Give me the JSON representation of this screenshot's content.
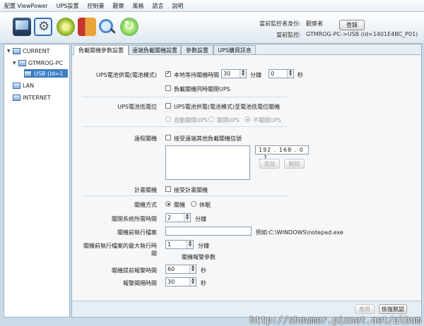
{
  "menu": [
    "配置 ViewPower",
    "UPS設置",
    "控制臺",
    "觀察",
    "風格",
    "語言",
    "說明"
  ],
  "toolbar": {
    "monitor_identity_label": "當前監控者身份:",
    "monitor_identity_value": "觀察者",
    "login_button": "登錄",
    "current_monitor_label": "當前監控:",
    "current_monitor_value": "GTMROG-PC->USB (id=1401E4BC_P01)"
  },
  "tree": {
    "items": [
      {
        "label": "CURRENT"
      },
      {
        "label": "GTMROG-PC"
      },
      {
        "label": "USB (Id=1"
      },
      {
        "label": "LAN"
      },
      {
        "label": "INTERNET"
      }
    ]
  },
  "tabs": [
    "負載關機參數設置",
    "遠端負載關機設置",
    "參數設置",
    "UPS購買訊息"
  ],
  "battery_mode": {
    "label": "UPS電池供電(電池模式)",
    "wait_label": "本地等待關機時間",
    "wait_value": "30",
    "minutes_unit": "分鐘",
    "seconds_value": "0",
    "seconds_unit": "秒",
    "shutdown_ups_label": "負載關機同時關閉UPS"
  },
  "low_battery": {
    "label": "UPS電池低電位",
    "check_label": "UPS電池供電(電池模式)至電池低電位關機",
    "options": [
      "自動關閉UPS",
      "關閉UPS",
      "不關閉UPS"
    ]
  },
  "remote": {
    "label": "遠程關機",
    "check_label": "接受遠端其他負載關機信號",
    "ip_value": "192 . 168 .  0  .  1",
    "add_button": "添加",
    "delete_button": "刪除"
  },
  "schedule": {
    "label": "計畫關機",
    "check_label": "接受計畫關機"
  },
  "shutdown_mode": {
    "label": "關機方式",
    "options": [
      "關機",
      "休眠"
    ]
  },
  "os_shutdown": {
    "label": "關閉系統所需時間",
    "value": "2",
    "unit": "分鐘"
  },
  "pre_file": {
    "label": "關機前執行檔案",
    "example": "例如:C:\\WINDOWS\\notepad.exe"
  },
  "pre_file_time": {
    "label": "關機前執行檔案的最大執行時間",
    "value": "1",
    "unit": "分鐘"
  },
  "warning": {
    "heading": "關機報警參數",
    "advance_label": "關機提前報警時間",
    "advance_value": "60",
    "interval_label": "報警間隔時間",
    "interval_value": "30",
    "unit": "秒"
  },
  "bottom": {
    "apply_button": "應用",
    "default_button": "恢復默認"
  },
  "watermark": "http://showmer.pixnet.net/album"
}
